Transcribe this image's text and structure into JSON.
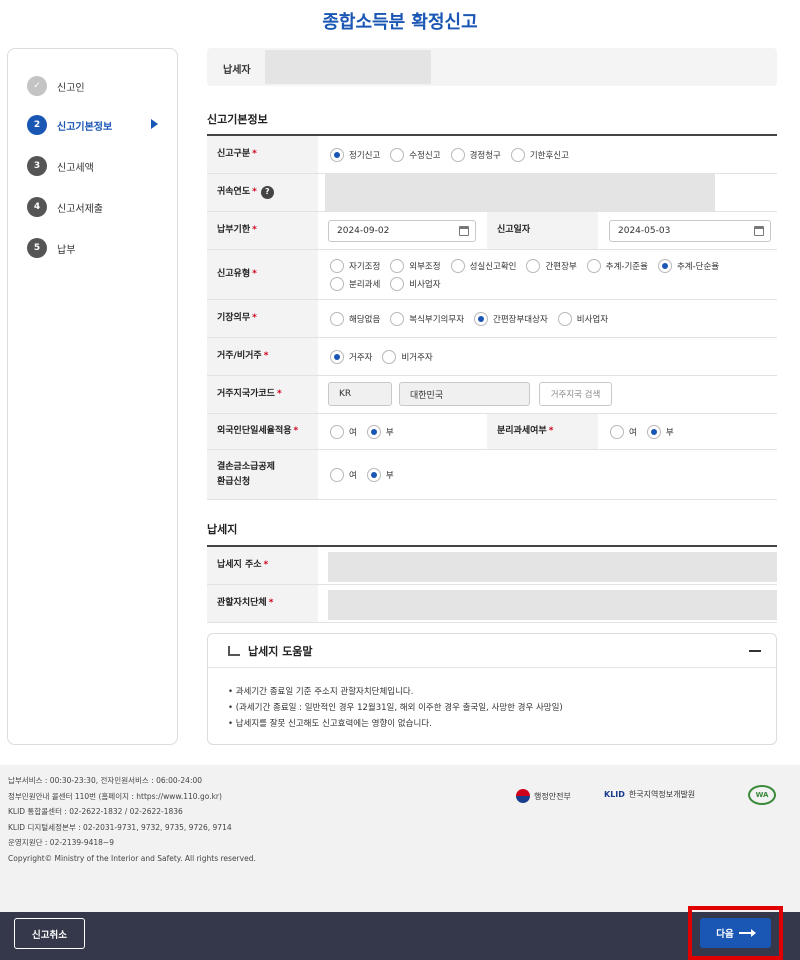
{
  "page_title": "종합소득분 확정신고",
  "steps": [
    {
      "num": "✓",
      "label": "신고인"
    },
    {
      "num": "2",
      "label": "신고기본정보"
    },
    {
      "num": "3",
      "label": "신고세액"
    },
    {
      "num": "4",
      "label": "신고서제출"
    },
    {
      "num": "5",
      "label": "납부"
    }
  ],
  "payer": {
    "label": "납세자"
  },
  "section_basic": "신고기본정보",
  "form": {
    "report_type": {
      "label": "신고구분",
      "options": [
        "정기신고",
        "수정신고",
        "경정청구",
        "기한후신고"
      ],
      "selected": "정기신고"
    },
    "tax_year": {
      "label": "귀속연도",
      "help": "?"
    },
    "due_date": {
      "label": "납부기한",
      "value": "2024-09-02"
    },
    "report_date": {
      "label": "신고일자",
      "value": "2024-05-03"
    },
    "filing_type": {
      "label": "신고유형",
      "options": [
        "자기조정",
        "외부조정",
        "성실신고확인",
        "간편장부",
        "추계-기준율",
        "추계-단순율",
        "분리과세",
        "비사업자"
      ],
      "selected": "추계-단순율"
    },
    "bookkeeping": {
      "label": "기장의무",
      "options": [
        "해당없음",
        "복식부기의무자",
        "간편장부대상자",
        "비사업자"
      ],
      "selected": "간편장부대상자"
    },
    "residency": {
      "label": "거주/비거주",
      "options": [
        "거주자",
        "비거주자"
      ],
      "selected": "거주자"
    },
    "country_code": {
      "label": "거주지국가코드",
      "code": "KR",
      "name": "대한민국",
      "search_label": "거주지국 검색"
    },
    "foreign_flat_rate": {
      "label": "외국인단일세율적용",
      "options": [
        "여",
        "부"
      ],
      "selected": "부"
    },
    "separate_tax": {
      "label": "분리과세여부",
      "options": [
        "여",
        "부"
      ],
      "selected": "부"
    },
    "loss_refund": {
      "label_line1": "결손금소급공제",
      "label_line2": "환급신청",
      "options": [
        "여",
        "부"
      ],
      "selected": "부"
    }
  },
  "section_residence": "납세지",
  "residence": {
    "address_label": "납세지 주소",
    "authority_label": "관할자치단체"
  },
  "help": {
    "title": "납세지 도움말",
    "items": [
      "과세기간 종료일 기준 주소지 관할자치단체입니다.",
      "(과세기간 종료일 : 일반적인 경우 12월31일, 해외 이주한 경우 출국일, 사망한 경우 사망일)",
      "납세지를 잘못 신고해도 신고효력에는 영향이 없습니다."
    ]
  },
  "footer": {
    "lines": [
      "납부서비스 : 00:30-23:30, 전자민원서비스 : 06:00-24:00",
      "정부민원안내 콜센터 110번 (홈페이지 : https://www.110.go.kr)",
      "KLID 통합콜센터 : 02-2622-1832 / 02-2622-1836",
      "KLID 디지털세정본부 : 02-2031-9731, 9732, 9735, 9726, 9714",
      "운영지원단 : 02-2139-9418~9",
      "Copyright© Ministry of the Interior and Safety. All rights reserved."
    ],
    "logo1": "행정안전부",
    "logo2_brand": "KLID",
    "logo2_name": "한국지역정보개발원",
    "logo3": "WA"
  },
  "bottom": {
    "cancel_label": "신고취소",
    "next_label": "다음"
  },
  "colors": {
    "accent": "#1a56b4",
    "highlight": "#e00000",
    "bar": "#34384a"
  }
}
